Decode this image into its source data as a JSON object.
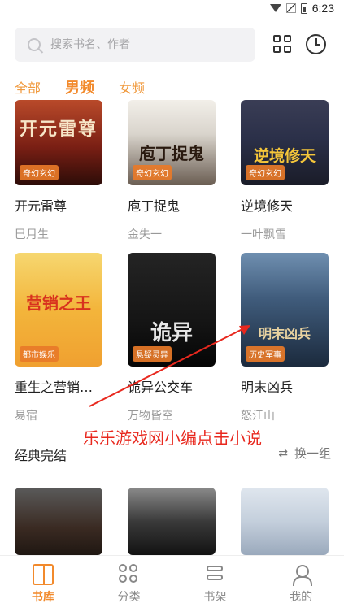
{
  "status_bar": {
    "time": "6:23"
  },
  "search": {
    "placeholder": "搜索书名、作者"
  },
  "tabs": [
    {
      "label": "全部",
      "active": false
    },
    {
      "label": "男频",
      "active": true
    },
    {
      "label": "女频",
      "active": false
    }
  ],
  "books_row1": [
    {
      "title": "开元雷尊",
      "author": "巳月生",
      "genre": "奇幻玄幻",
      "cover_text": "开元雷尊"
    },
    {
      "title": "庖丁捉鬼",
      "author": "金失一",
      "genre": "奇幻玄幻",
      "cover_text": "庖丁捉鬼"
    },
    {
      "title": "逆境修天",
      "author": "一叶飘雪",
      "genre": "奇幻玄幻",
      "cover_text": "逆境修天"
    }
  ],
  "books_row2": [
    {
      "title": "重生之营销之王",
      "author": "易宿",
      "genre": "都市娱乐",
      "cover_text": "营销之王"
    },
    {
      "title": "诡异公交车",
      "author": "万物皆空",
      "genre": "悬疑灵异",
      "cover_text": "诡异"
    },
    {
      "title": "明末凶兵",
      "author": "怒江山",
      "genre": "历史军事",
      "cover_text": "明末凶兵"
    }
  ],
  "annotation": {
    "text": "乐乐游戏网小编点击小说"
  },
  "section": {
    "title": "经典完结",
    "switch_label": "换一组"
  },
  "bottom_nav": [
    {
      "label": "书库",
      "active": true,
      "icon": "book-icon"
    },
    {
      "label": "分类",
      "active": false,
      "icon": "category-icon"
    },
    {
      "label": "书架",
      "active": false,
      "icon": "shelf-icon"
    },
    {
      "label": "我的",
      "active": false,
      "icon": "profile-icon"
    }
  ],
  "colors": {
    "accent": "#f28a2c",
    "annotation": "#e8281e"
  }
}
